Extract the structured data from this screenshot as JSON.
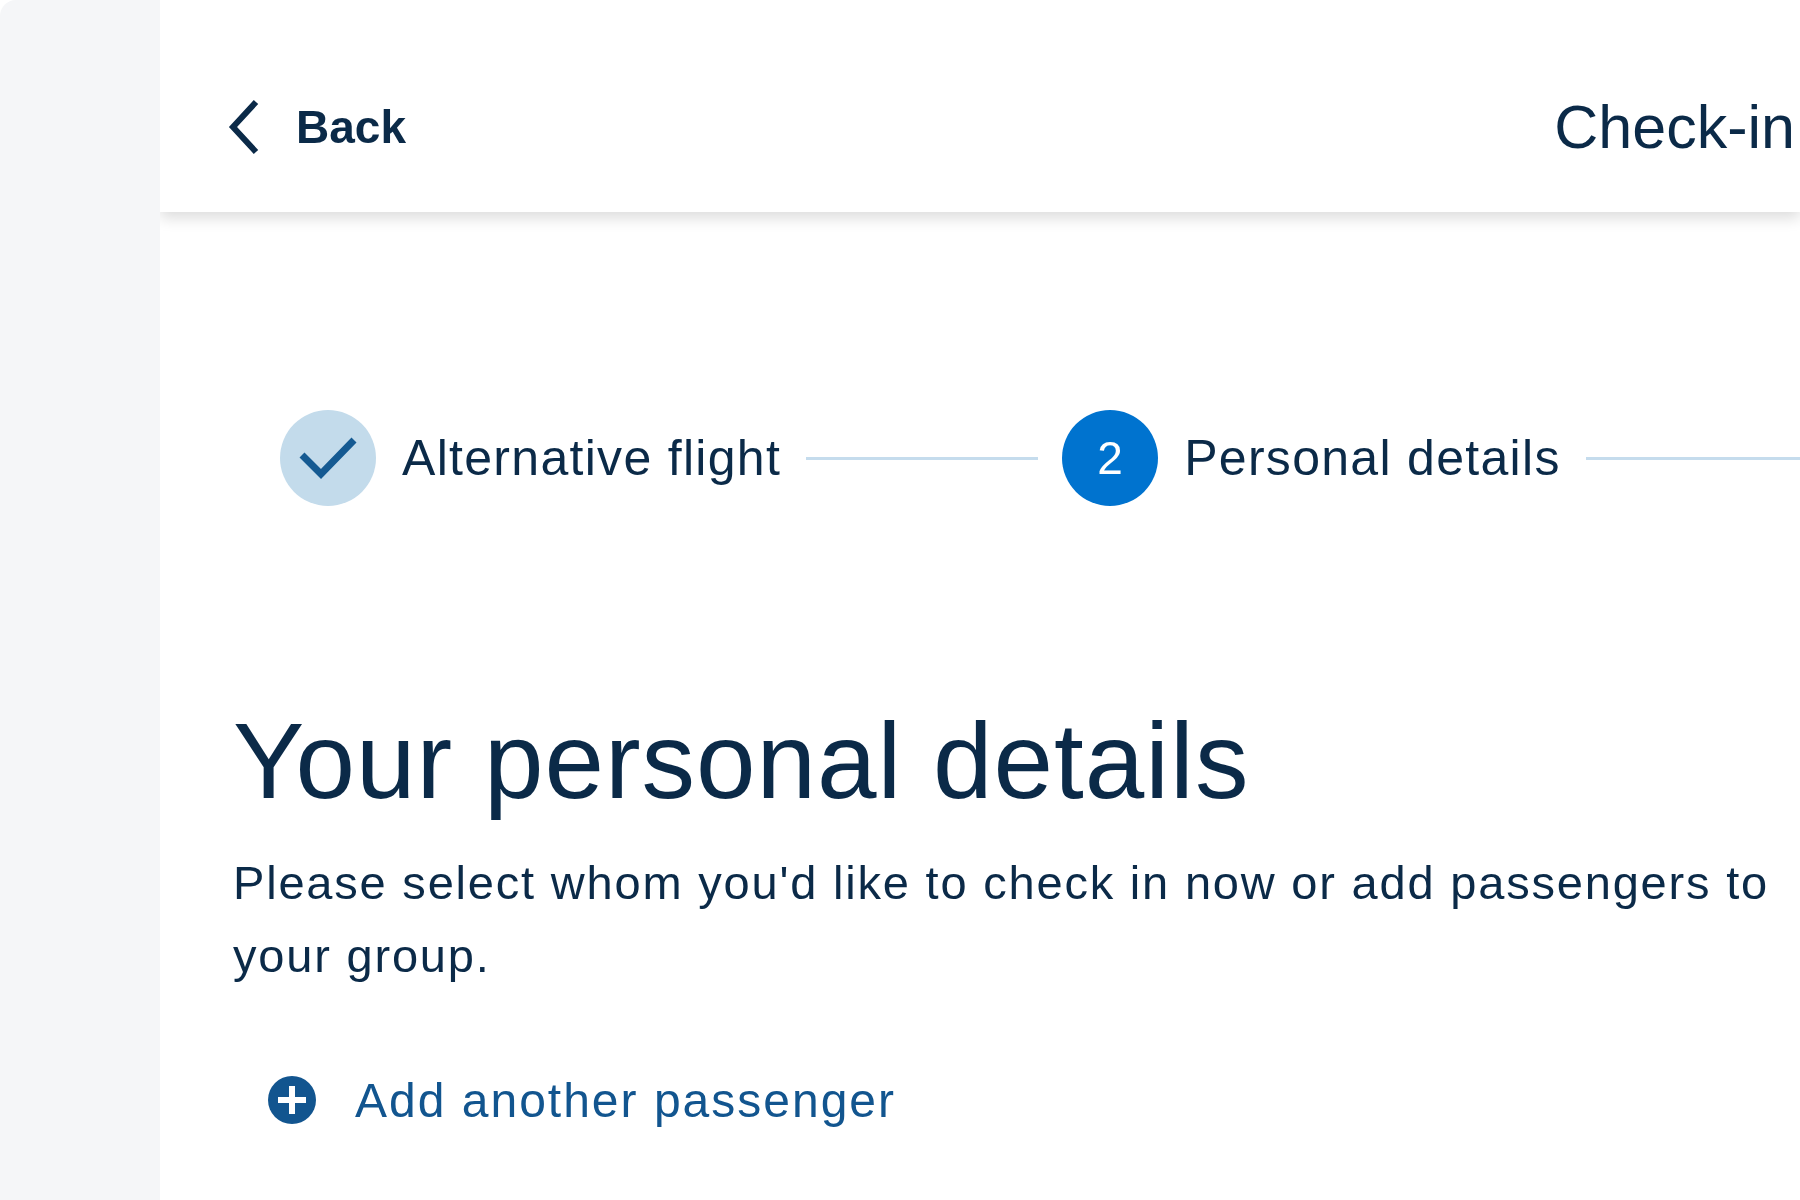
{
  "header": {
    "back": "Back",
    "title": "Check-in"
  },
  "stepper": [
    {
      "label": "Alternative flight",
      "completed": true,
      "selected": false
    },
    {
      "label": "Personal details",
      "number": "2",
      "completed": false,
      "selected": true
    }
  ],
  "heading": "Your personal details",
  "intro": "Please select whom you'd like to check in now or add passengers to your group.",
  "add_passenger": "Add another passenger"
}
